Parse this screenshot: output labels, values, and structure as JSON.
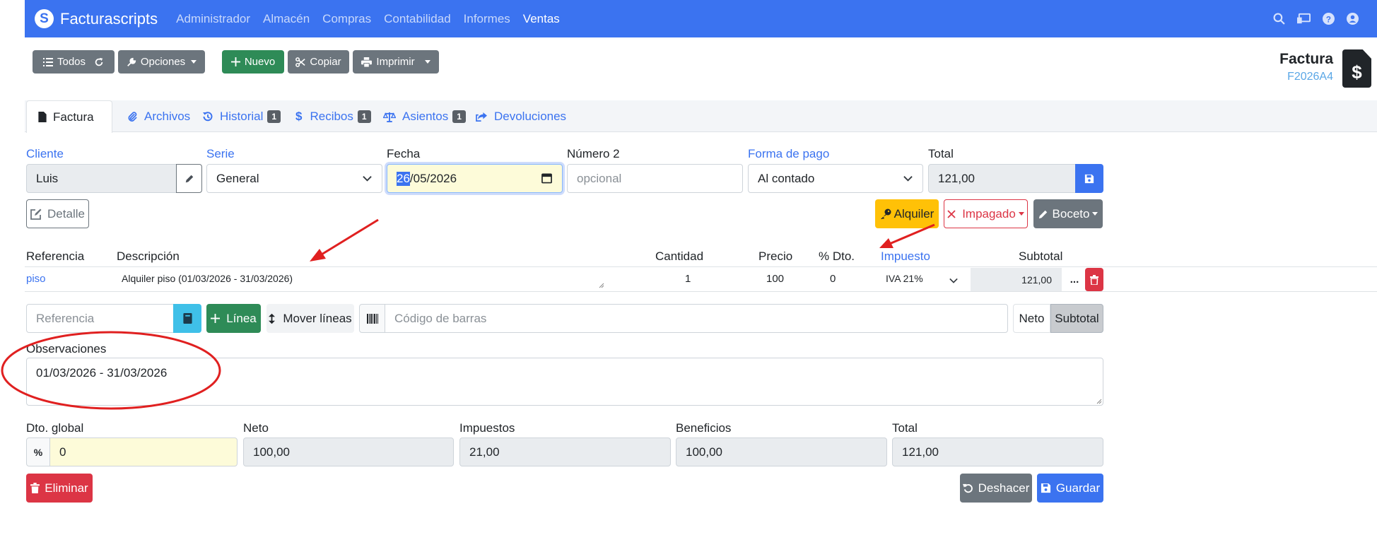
{
  "navbar": {
    "brand": "Facturascripts",
    "links": [
      "Administrador",
      "Almacén",
      "Compras",
      "Contabilidad",
      "Informes",
      "Ventas"
    ],
    "active": "Ventas"
  },
  "toolbar": {
    "todos": "Todos",
    "opciones": "Opciones",
    "nuevo": "Nuevo",
    "copiar": "Copiar",
    "imprimir": "Imprimir"
  },
  "document": {
    "title": "Factura",
    "code": "F2026A4"
  },
  "tabs": [
    {
      "label": "Factura",
      "badge": ""
    },
    {
      "label": "Archivos",
      "badge": ""
    },
    {
      "label": "Historial",
      "badge": "1"
    },
    {
      "label": "Recibos",
      "badge": "1"
    },
    {
      "label": "Asientos",
      "badge": "1"
    },
    {
      "label": "Devoluciones",
      "badge": ""
    }
  ],
  "header_form": {
    "cliente_label": "Cliente",
    "cliente_value": "Luis",
    "serie_label": "Serie",
    "serie_value": "General",
    "fecha_label": "Fecha",
    "fecha_sel": "26",
    "fecha_rest": "/05/2026",
    "numero2_label": "Número 2",
    "numero2_placeholder": "opcional",
    "forma_pago_label": "Forma de pago",
    "forma_pago_value": "Al contado",
    "total_label": "Total",
    "total_value": "121,00",
    "detalle": "Detalle",
    "alquiler": "Alquiler",
    "impagado": "Impagado",
    "boceto": "Boceto"
  },
  "lines": {
    "headers": {
      "referencia": "Referencia",
      "descripcion": "Descripción",
      "cantidad": "Cantidad",
      "precio": "Precio",
      "dto": "% Dto.",
      "impuesto": "Impuesto",
      "subtotal": "Subtotal"
    },
    "rows": [
      {
        "referencia": "piso",
        "descripcion": "Alquiler piso (01/03/2026 - 31/03/2026)",
        "cantidad": "1",
        "precio": "100",
        "dto": "0",
        "impuesto": "IVA 21%",
        "subtotal": "121,00",
        "more": "..."
      }
    ]
  },
  "add_line": {
    "referencia_placeholder": "Referencia",
    "linea": "Línea",
    "mover": "Mover líneas",
    "barcode_placeholder": "Código de barras",
    "neto": "Neto",
    "subtotal": "Subtotal"
  },
  "observaciones": {
    "label": "Observaciones",
    "value": "01/03/2026 - 31/03/2026"
  },
  "totals": {
    "dto_label": "Dto. global",
    "dto_value": "0",
    "neto_label": "Neto",
    "neto_value": "100,00",
    "impuestos_label": "Impuestos",
    "impuestos_value": "21,00",
    "beneficios_label": "Beneficios",
    "beneficios_value": "100,00",
    "total_label": "Total",
    "total_value": "121,00"
  },
  "actions": {
    "eliminar": "Eliminar",
    "deshacer": "Deshacer",
    "guardar": "Guardar"
  },
  "colors": {
    "primary": "#3b73f0",
    "success": "#2e8b57",
    "danger": "#dc3545",
    "warning": "#ffc107",
    "secondary": "#6c757d",
    "annotation": "#e02020"
  }
}
